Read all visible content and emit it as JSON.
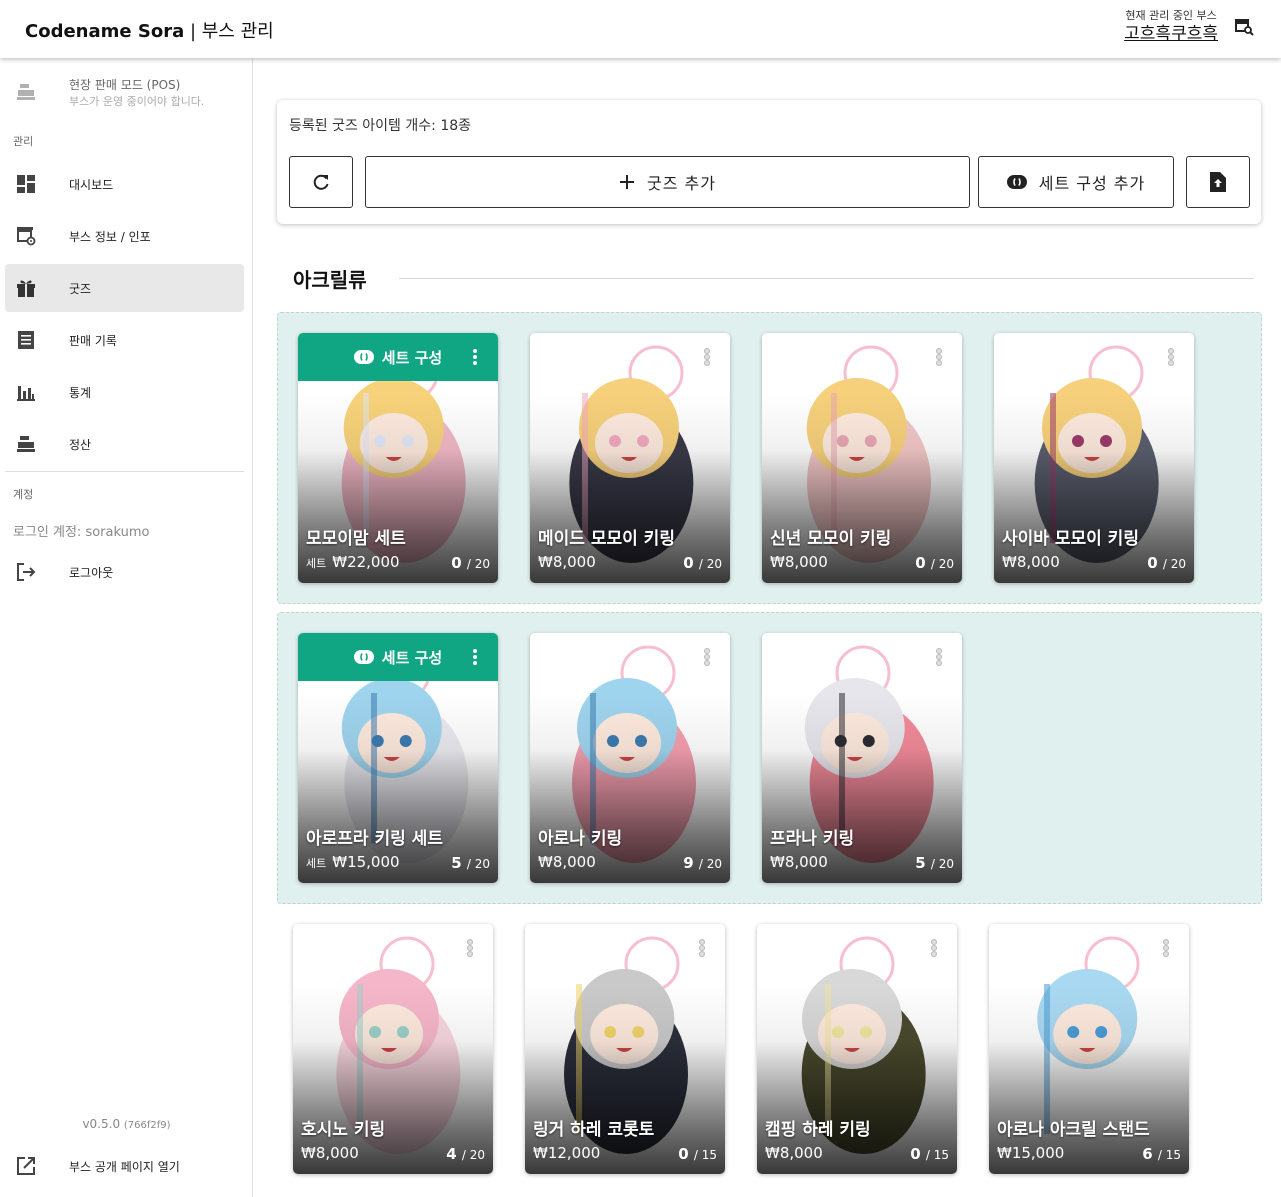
{
  "header": {
    "app_name": "Codename Sora",
    "separator": " | ",
    "section": "부스 관리",
    "booth_caption": "현재 관리 중인 부스",
    "booth_name": "고흐흑쿠흐흑"
  },
  "sidebar": {
    "pos": {
      "title": "현장 판매 모드 (POS)",
      "subtitle": "부스가 운영 중이어야 합니다."
    },
    "manage_label": "관리",
    "items": [
      {
        "label": "대시보드",
        "icon": "dashboard-icon"
      },
      {
        "label": "부스 정보 / 인포",
        "icon": "store-settings-icon"
      },
      {
        "label": "굿즈",
        "icon": "gift-icon",
        "active": true
      },
      {
        "label": "판매 기록",
        "icon": "receipt-icon"
      },
      {
        "label": "통계",
        "icon": "bar-chart-icon"
      },
      {
        "label": "정산",
        "icon": "register-icon"
      }
    ],
    "account_label": "계정",
    "login_text": "로그인 계정: sorakumo",
    "logout_label": "로그아웃",
    "version": "v0.5.0",
    "version_hash": "(766f2f9)",
    "open_public_label": "부스 공개 페이지 열기"
  },
  "toolbar": {
    "count_text": "등록된 굿즈 아이템 개수: 18종",
    "add_goods_label": "굿즈 추가",
    "add_set_label": "세트 구성 추가"
  },
  "category": {
    "title": "아크릴류"
  },
  "set_bar_label": "세트 구성",
  "set_tag": "세트",
  "groups": [
    {
      "cards": [
        {
          "name": "모모이맘 세트",
          "price": "₩22,000",
          "sold": "0",
          "total": "/ 20",
          "is_set": true,
          "palette": [
            "#f7d27a",
            "#f2b8c6",
            "#dfe6f5"
          ]
        },
        {
          "name": "메이드 모모이 키링",
          "price": "₩8,000",
          "sold": "0",
          "total": "/ 20",
          "palette": [
            "#f6d07b",
            "#3a3a4a",
            "#f2a9c0"
          ]
        },
        {
          "name": "신년 모모이 키링",
          "price": "₩8,000",
          "sold": "0",
          "total": "/ 20",
          "palette": [
            "#f6d07b",
            "#f2c6c6",
            "#e8a6b2"
          ]
        },
        {
          "name": "사이바 모모이 키링",
          "price": "₩8,000",
          "sold": "0",
          "total": "/ 20",
          "palette": [
            "#f6d07b",
            "#5b5f6e",
            "#9b3a6a"
          ]
        }
      ]
    },
    {
      "cards": [
        {
          "name": "아로프라 키링 세트",
          "price": "₩15,000",
          "sold": "5",
          "total": "/ 20",
          "is_set": true,
          "palette": [
            "#9fd4ee",
            "#e9e9ef",
            "#3d7bb0"
          ]
        },
        {
          "name": "아로나 키링",
          "price": "₩8,000",
          "sold": "9",
          "total": "/ 20",
          "palette": [
            "#9fd4ee",
            "#f59fb0",
            "#3d7bb0"
          ]
        },
        {
          "name": "프라나 키링",
          "price": "₩8,000",
          "sold": "5",
          "total": "/ 20",
          "palette": [
            "#e6e6ec",
            "#f28a9a",
            "#2b2b33"
          ]
        }
      ]
    }
  ],
  "singles": [
    {
      "name": "호시노 키링",
      "price": "₩8,000",
      "sold": "4",
      "total": "/ 20",
      "palette": [
        "#f6b6c9",
        "#f8d6e0",
        "#9ad0c9"
      ]
    },
    {
      "name": "링거 하레 코롯토",
      "price": "₩12,000",
      "sold": "0",
      "total": "/ 15",
      "palette": [
        "#c9c9c9",
        "#2b2f3b",
        "#f1d36a"
      ]
    },
    {
      "name": "캠핑 하레 키링",
      "price": "₩8,000",
      "sold": "0",
      "total": "/ 15",
      "palette": [
        "#d8d8d8",
        "#4a4a2e",
        "#f0e6a0"
      ]
    },
    {
      "name": "아로나 아크릴 스탠드",
      "price": "₩15,000",
      "sold": "6",
      "total": "/ 15",
      "palette": [
        "#a9d9f2",
        "#ffffff",
        "#4b9bd6"
      ]
    }
  ]
}
